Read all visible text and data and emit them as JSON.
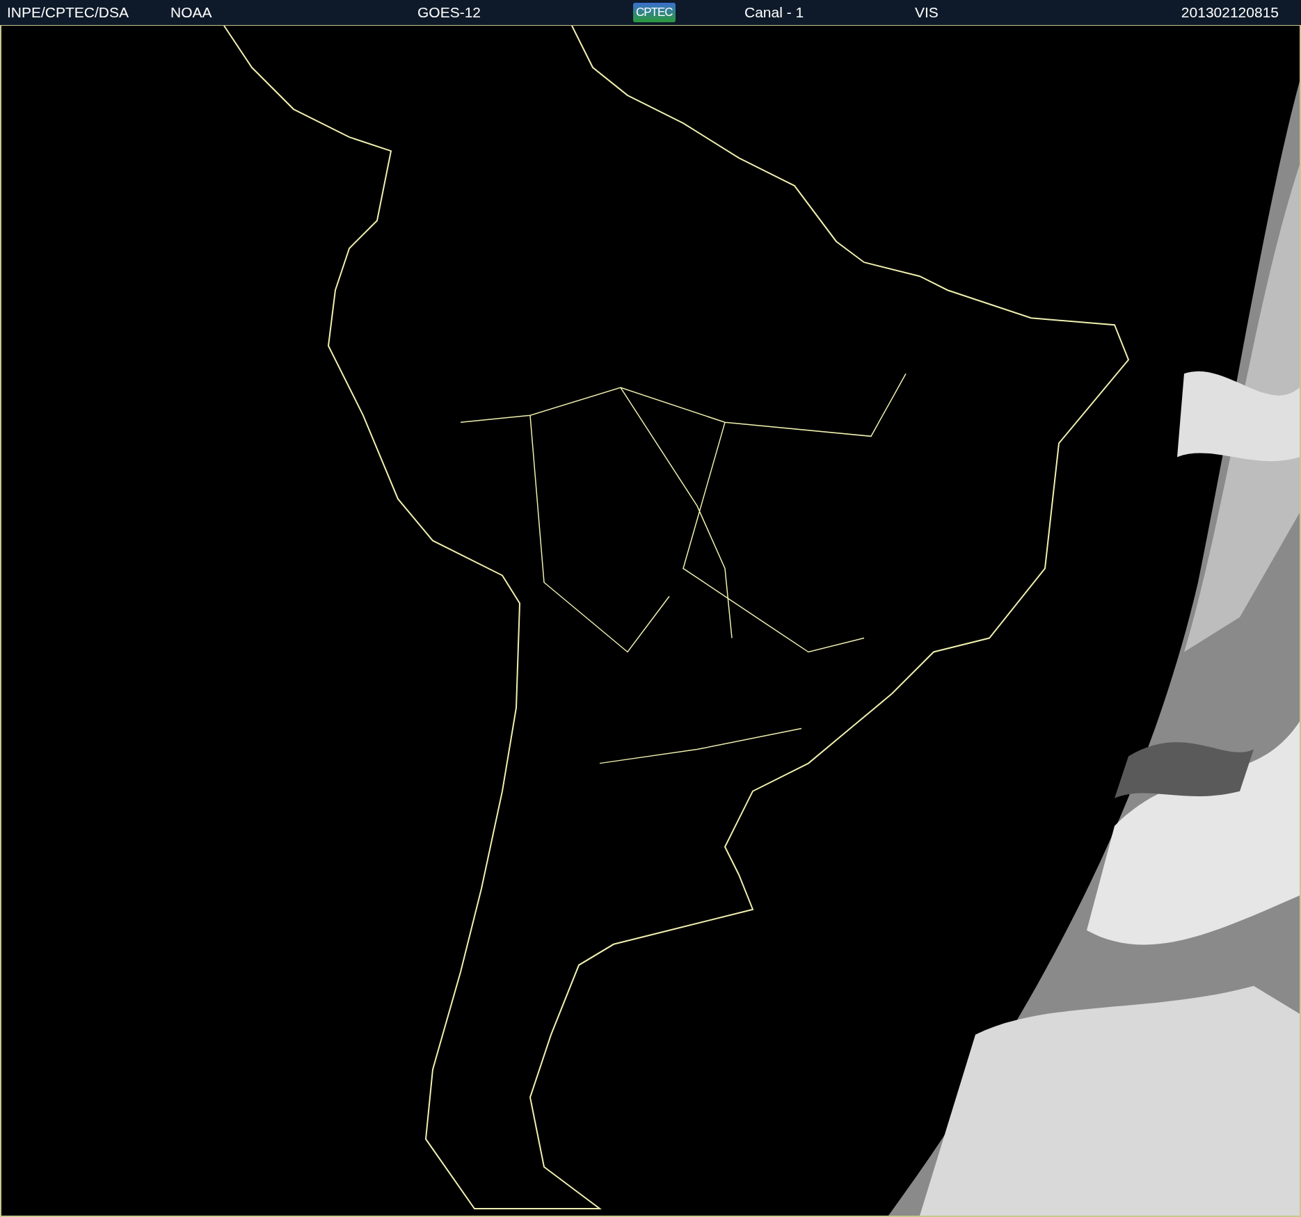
{
  "header": {
    "items": [
      {
        "kind": "text",
        "text": "INPE/CPTEC/DSA"
      },
      {
        "kind": "text",
        "text": "NOAA"
      },
      {
        "kind": "text",
        "text": "GOES-12"
      },
      {
        "kind": "logo",
        "text": "CPTEC"
      },
      {
        "kind": "text",
        "text": "Canal - 1"
      },
      {
        "kind": "text",
        "text": "VIS"
      },
      {
        "kind": "text",
        "text": "201302120815"
      }
    ]
  }
}
